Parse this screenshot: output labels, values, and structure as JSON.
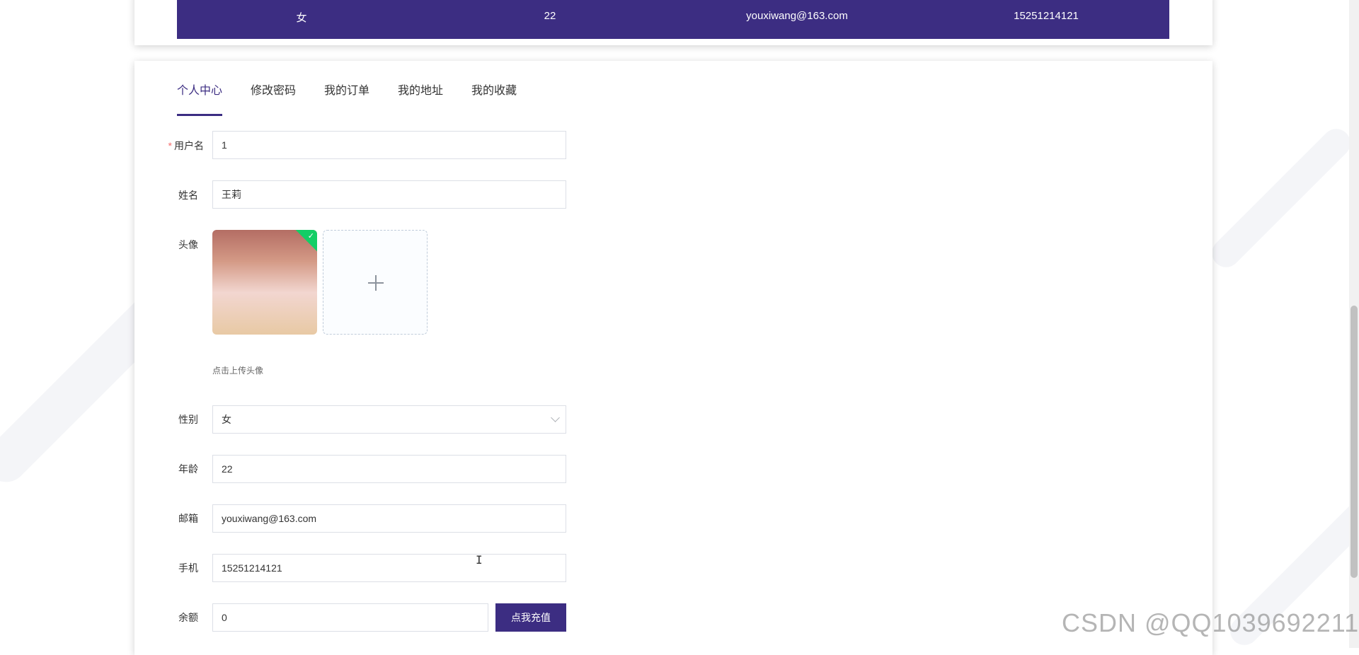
{
  "info_bar": {
    "gender": "女",
    "age": "22",
    "email": "youxiwang@163.com",
    "phone": "15251214121"
  },
  "tabs": [
    {
      "label": "个人中心",
      "active": true
    },
    {
      "label": "修改密码",
      "active": false
    },
    {
      "label": "我的订单",
      "active": false
    },
    {
      "label": "我的地址",
      "active": false
    },
    {
      "label": "我的收藏",
      "active": false
    }
  ],
  "form": {
    "required_mark": "*",
    "username": {
      "label": "用户名",
      "value": "1"
    },
    "name": {
      "label": "姓名",
      "value": "王莉"
    },
    "avatar": {
      "label": "头像",
      "tip": "点击上传头像"
    },
    "gender": {
      "label": "性别",
      "value": "女"
    },
    "age": {
      "label": "年龄",
      "value": "22"
    },
    "email": {
      "label": "邮箱",
      "value": "youxiwang@163.com"
    },
    "phone": {
      "label": "手机",
      "value": "15251214121"
    },
    "balance": {
      "label": "余额",
      "value": "0",
      "button": "点我充值"
    }
  },
  "watermark": "CSDN @QQ1039692211",
  "cursor_glyph": "I",
  "colors": {
    "primary": "#3c2d82",
    "required": "#f56c6c",
    "success": "#13ce66"
  },
  "icons": {
    "upload": "plus-icon",
    "select": "chevron-down-icon",
    "uploaded": "check-icon"
  }
}
